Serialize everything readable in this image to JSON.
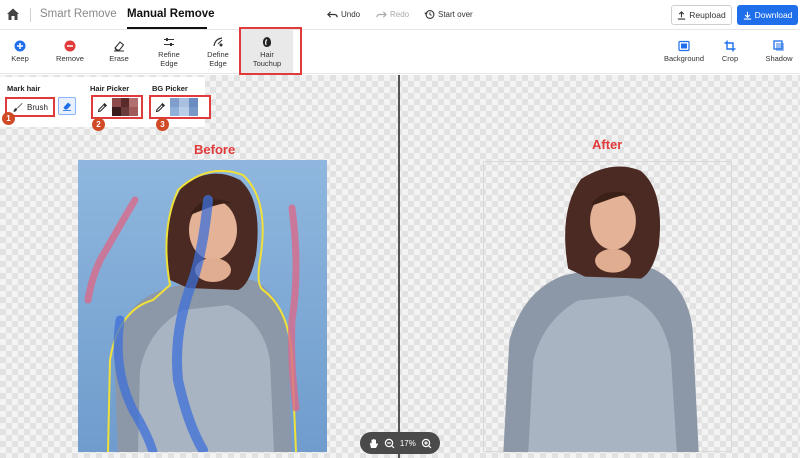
{
  "header": {
    "tabs": [
      {
        "label": "Smart Remove"
      },
      {
        "label": "Manual Remove"
      }
    ],
    "history": {
      "undo": "Undo",
      "redo": "Redo",
      "start_over": "Start over"
    },
    "reupload_label": "Reupload",
    "download_label": "Download"
  },
  "toolbar": {
    "keep": "Keep",
    "remove": "Remove",
    "erase": "Erase",
    "refine_1": "Refine",
    "refine_2": "Edge",
    "define_1": "Define",
    "define_2": "Edge",
    "hair_1": "Hair",
    "hair_2": "Touchup",
    "background": "Background",
    "crop": "Crop",
    "shadow": "Shadow"
  },
  "hair_panel": {
    "mark_hair_label": "Mark hair",
    "brush_label": "Brush",
    "hair_picker_label": "Hair Picker",
    "bg_picker_label": "BG Picker",
    "hair_swatch_colors": [
      "#8c4a4a",
      "#5a2a2a",
      "#b07070",
      "#3a1c1c",
      "#6b3a3a",
      "#a05a5a"
    ],
    "bg_swatch_colors": [
      "#7f9ecb",
      "#a9c0e0",
      "#6a8cc0",
      "#8fb0d8",
      "#b8cde6",
      "#7898c8"
    ]
  },
  "annotations": {
    "badge_1": "1",
    "badge_2": "2",
    "badge_3": "3"
  },
  "captions": {
    "before": "Before",
    "after": "After"
  },
  "zoom": {
    "level": "17%"
  },
  "colors": {
    "accent": "#1f6feb",
    "highlight": "#e03a3a",
    "badge": "#d04a26"
  }
}
